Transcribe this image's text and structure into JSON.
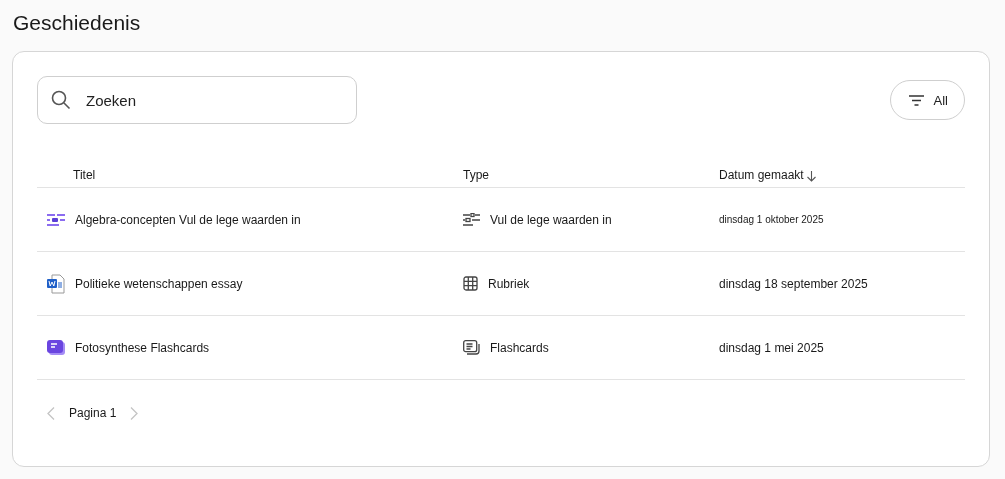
{
  "page_title": "Geschiedenis",
  "search": {
    "placeholder": "Zoeken"
  },
  "filter": {
    "label": "All"
  },
  "table": {
    "columns": [
      {
        "label": "Titel",
        "sorted": false
      },
      {
        "label": "Type",
        "sorted": false
      },
      {
        "label": "Datum gemaakt",
        "sorted": true
      }
    ],
    "rows": [
      {
        "kind": "fill-in",
        "title": "Algebra-concepten Vul de lege waarden in",
        "type": "Vul de lege waarden in",
        "date": "dinsdag 1 oktober 2025",
        "compact": true
      },
      {
        "kind": "rubric",
        "title": "Politieke wetenschappen essay",
        "type": "Rubriek",
        "date": "dinsdag 18 september 2025",
        "compact": false
      },
      {
        "kind": "flashcards",
        "title": "Fotosynthese Flashcards",
        "type": "Flashcards",
        "date": "dinsdag 1 mei 2025",
        "compact": false
      }
    ]
  },
  "pagination": {
    "label": "Pagina 1",
    "prev_disabled": true,
    "next_disabled": true
  }
}
